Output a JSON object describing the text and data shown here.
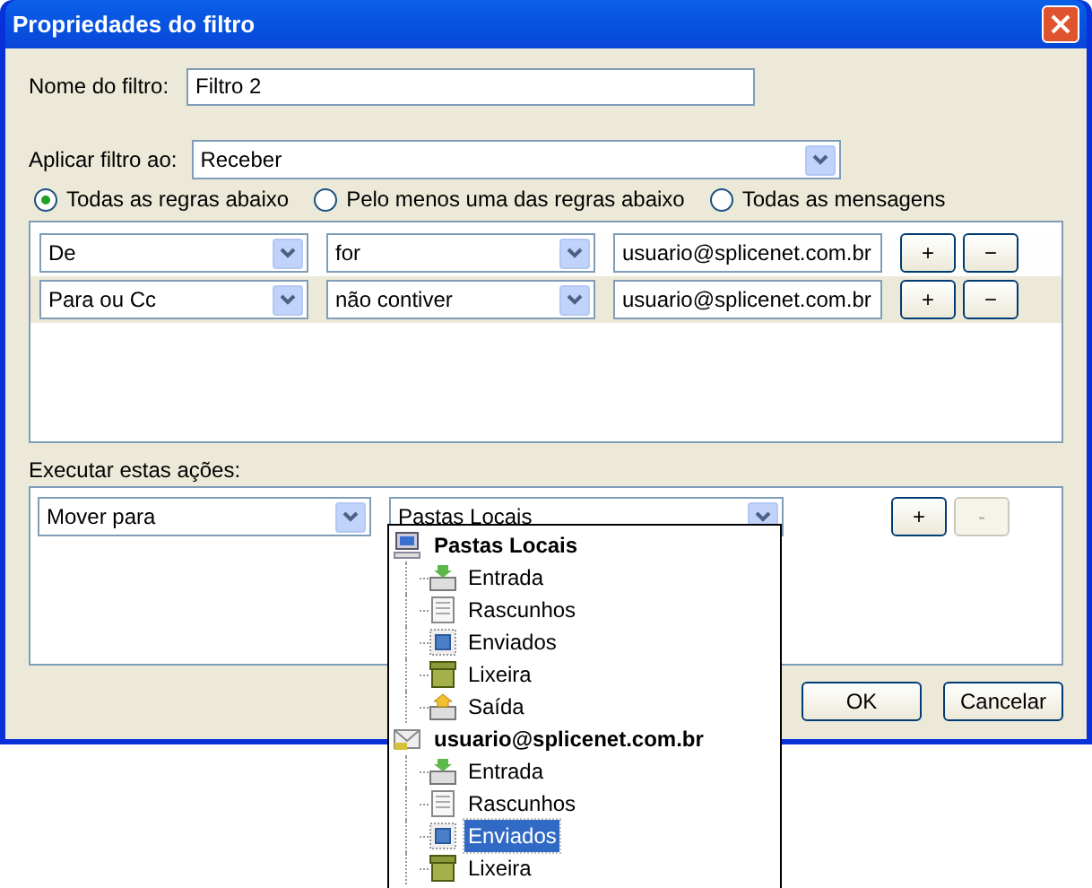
{
  "window": {
    "title": "Propriedades do filtro"
  },
  "filter_name": {
    "label": "Nome do filtro:",
    "value": "Filtro 2"
  },
  "apply_to": {
    "label": "Aplicar filtro ao:",
    "value": "Receber"
  },
  "match_options": [
    {
      "label": "Todas as regras abaixo",
      "selected": true
    },
    {
      "label": "Pelo menos uma das regras abaixo",
      "selected": false
    },
    {
      "label": "Todas as mensagens",
      "selected": false
    }
  ],
  "rules": [
    {
      "field": "De",
      "operator": "for",
      "value": "usuario@splicenet.com.br",
      "add": "+",
      "remove": "−",
      "highlighted": false
    },
    {
      "field": "Para ou Cc",
      "operator": "não contiver",
      "value": "usuario@splicenet.com.br",
      "add": "+",
      "remove": "−",
      "highlighted": true
    }
  ],
  "actions_label": "Executar estas ações:",
  "actions": [
    {
      "action": "Mover para",
      "target": "Pastas Locais",
      "add": "+",
      "remove": "-",
      "remove_disabled": true
    }
  ],
  "folder_dropdown": [
    {
      "label": "Pastas Locais",
      "kind": "computer",
      "selected": false,
      "children": [
        {
          "label": "Entrada",
          "kind": "inbox",
          "selected": false
        },
        {
          "label": "Rascunhos",
          "kind": "drafts",
          "selected": false
        },
        {
          "label": "Enviados",
          "kind": "sent",
          "selected": false
        },
        {
          "label": "Lixeira",
          "kind": "trash",
          "selected": false
        },
        {
          "label": "Saída",
          "kind": "outbox",
          "selected": false
        }
      ]
    },
    {
      "label": "usuario@splicenet.com.br",
      "kind": "account",
      "selected": false,
      "children": [
        {
          "label": "Entrada",
          "kind": "inbox",
          "selected": false
        },
        {
          "label": "Rascunhos",
          "kind": "drafts",
          "selected": false
        },
        {
          "label": "Enviados",
          "kind": "sent",
          "selected": true
        },
        {
          "label": "Lixeira",
          "kind": "trash",
          "selected": false
        }
      ]
    }
  ],
  "buttons": [
    "OK",
    "Cancelar"
  ]
}
